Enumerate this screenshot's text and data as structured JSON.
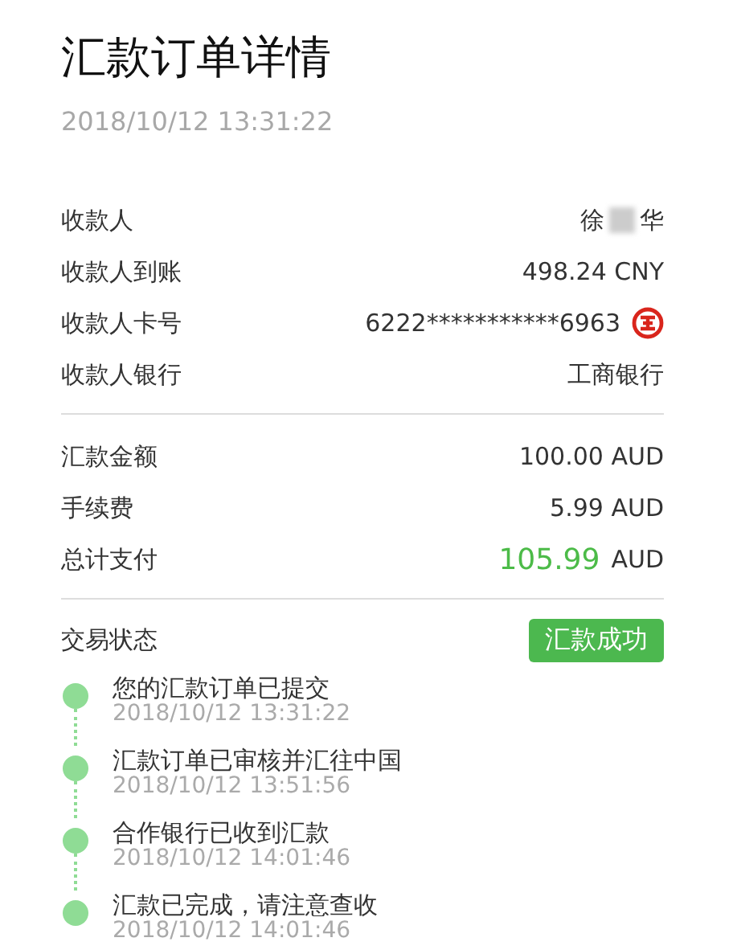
{
  "title": "汇款订单详情",
  "date": "2018/10/12 13:31:22",
  "payee_rows": [
    {
      "kind": "name",
      "label": "收款人",
      "value_parts": [
        "徐",
        "华"
      ],
      "redacted": true
    },
    {
      "kind": "text",
      "label": "收款人到账",
      "value": "498.24 CNY"
    },
    {
      "kind": "card",
      "label": "收款人卡号",
      "value": "6222***********6963"
    },
    {
      "kind": "text",
      "label": "收款人银行",
      "value": "工商银行"
    }
  ],
  "amount_rows": [
    {
      "kind": "text",
      "label": "汇款金额",
      "value": "100.00 AUD"
    },
    {
      "kind": "text",
      "label": "手续费",
      "value": "5.99 AUD"
    },
    {
      "kind": "total",
      "label": "总计支付",
      "amount": "105.99",
      "currency": "AUD"
    }
  ],
  "status": {
    "label": "交易状态",
    "badge": "汇款成功"
  },
  "timeline": [
    {
      "text": "您的汇款订单已提交",
      "time": "2018/10/12 13:31:22"
    },
    {
      "text": "汇款订单已审核并汇往中国",
      "time": "2018/10/12 13:51:56"
    },
    {
      "text": "合作银行已收到汇款",
      "time": "2018/10/12 14:01:46"
    },
    {
      "text": "汇款已完成，请注意查收",
      "time": "2018/10/12 14:01:46"
    }
  ]
}
